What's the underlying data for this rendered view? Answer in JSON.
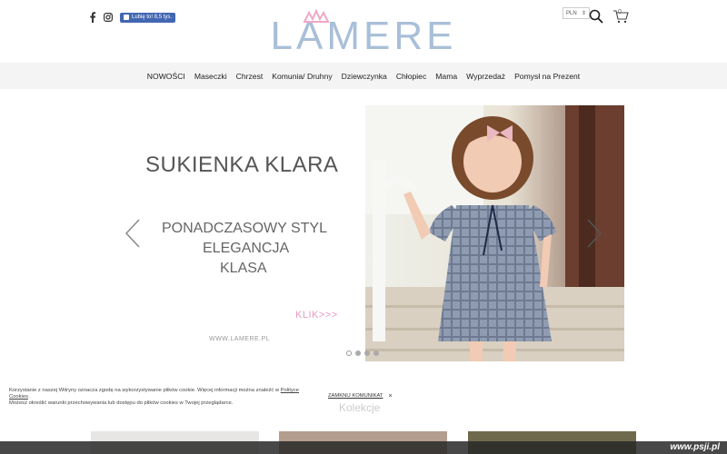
{
  "header": {
    "logo_text": "LAMERE",
    "like_button": "Lubię to! 8,5 tys.",
    "currency": "PLN",
    "cart_count": "0"
  },
  "nav": {
    "items": [
      {
        "label": "NOWOŚCI"
      },
      {
        "label": "Maseczki"
      },
      {
        "label": "Chrzest"
      },
      {
        "label": "Komunia/ Druhny"
      },
      {
        "label": "Dziewczynka"
      },
      {
        "label": "Chłopiec"
      },
      {
        "label": "Mama"
      },
      {
        "label": "Wyprzedaż"
      },
      {
        "label": "Pomysł na Prezent"
      }
    ]
  },
  "hero": {
    "title": "SUKIENKA KLARA",
    "line1": "PONADCZASOWY STYL",
    "line2": "ELEGANCJA",
    "line3": "KLASA",
    "cta": "KLIK>>>",
    "site": "WWW.LAMERE.PL",
    "active_slide": 1,
    "slide_count": 4
  },
  "cookie": {
    "text1": "Korzystanie z naszej Witryny oznacza zgodę na wykorzystywanie plików cookie. Więcej informacji można znaleźć w",
    "link": "Polityce Cookies",
    "text2": "Możesz określić warunki przechowywania lub dostępu do plików cookies w Twojej przeglądarce.",
    "close": "ZAMKNIJ KOMUNIKAT",
    "close_x": "×"
  },
  "section": {
    "title": "Kolekcje"
  },
  "watermark": "www.psji.pl",
  "colors": {
    "logo": "#a9bfd8",
    "crown": "#f0a8c6",
    "accent_pink": "#e79ac6",
    "nav_bg": "#f4f4f4"
  }
}
